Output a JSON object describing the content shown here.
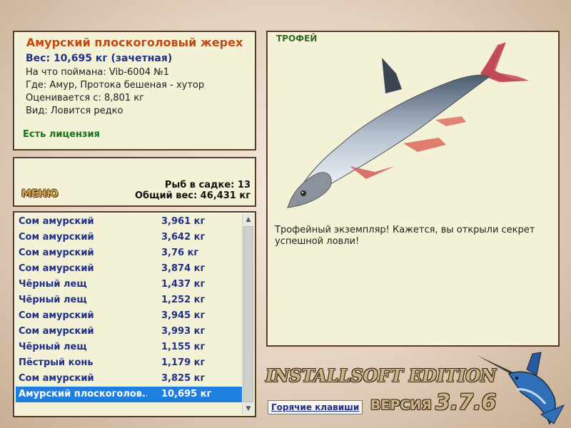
{
  "info": {
    "fish_name": "Амурский плоскоголовый жерех",
    "weight": "Вес: 10,695 кг (зачетная)",
    "caught_on": "На что поймана: Vib-6004 №1",
    "location": "Где: Амур, Протока бешеная - хутор",
    "valued_from": "Оценивается с: 8,801 кг",
    "rarity": "Вид: Ловится редко",
    "license": "Есть лицензия"
  },
  "summary": {
    "menu_label": "МЕНЮ",
    "fish_in_keepnet": "Рыб в садке: 13",
    "total_weight": "Общий вес: 46,431 кг"
  },
  "catch_list": [
    {
      "name": "Сом амурский",
      "weight": "3,961 кг"
    },
    {
      "name": "Сом амурский",
      "weight": "3,642 кг"
    },
    {
      "name": "Сом амурский",
      "weight": "3,76 кг"
    },
    {
      "name": "Сом амурский",
      "weight": "3,874 кг"
    },
    {
      "name": "Чёрный лещ",
      "weight": "1,437 кг"
    },
    {
      "name": "Чёрный лещ",
      "weight": "1,252 кг"
    },
    {
      "name": "Сом амурский",
      "weight": "3,945 кг"
    },
    {
      "name": "Сом амурский",
      "weight": "3,993 кг"
    },
    {
      "name": "Чёрный лещ",
      "weight": "1,155 кг"
    },
    {
      "name": "Пёстрый конь",
      "weight": "1,179 кг"
    },
    {
      "name": "Сом амурский",
      "weight": "3,825 кг"
    },
    {
      "name": "Амурский плоскоголов...",
      "weight": "10,695 кг",
      "selected": true
    }
  ],
  "trophy": {
    "label": "ТРОФЕЙ",
    "description": "Трофейный экземпляр! Кажется, вы открыли секрет успешной ловли!"
  },
  "footer": {
    "edition": "INSTALLSOFT EDITION",
    "version_label": "ВЕРСИЯ",
    "version_number": "3.7.6",
    "hotkeys": "Горячие клавиши"
  },
  "colors": {
    "title": "#c04a10",
    "accent_blue": "#1f2f8a",
    "selection": "#1f7fe0",
    "license_green": "#147318",
    "panel_bg": "#f3f1d6"
  },
  "icons": {
    "scroll_up": "scroll-up-arrow-icon",
    "scroll_down": "scroll-down-arrow-icon",
    "logo": "marlin-logo-icon",
    "trophy_image": "asp-fish-image"
  }
}
